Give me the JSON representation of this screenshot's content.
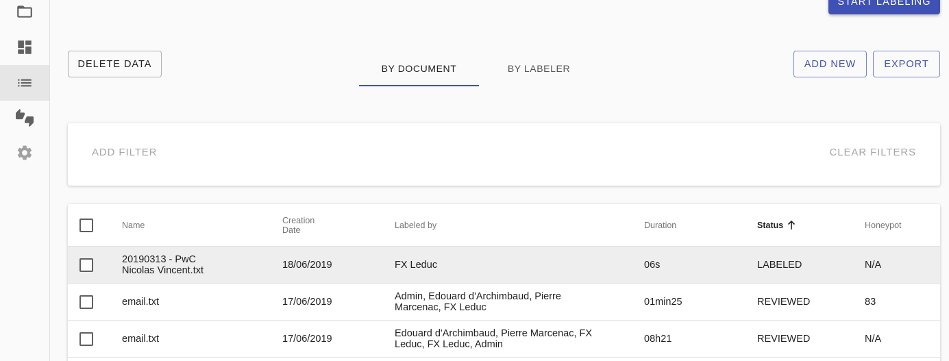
{
  "sidebar": {
    "items": [
      {
        "icon": "folder-icon"
      },
      {
        "icon": "dashboard-icon"
      },
      {
        "icon": "list-icon",
        "active": true
      },
      {
        "icon": "thumbs-up-down-icon"
      },
      {
        "icon": "settings-icon"
      }
    ]
  },
  "toolbar": {
    "start_label": "START LABELING",
    "delete_label": "DELETE DATA",
    "add_new_label": "ADD NEW",
    "export_label": "EXPORT"
  },
  "tabs": [
    {
      "label": "BY DOCUMENT",
      "active": true
    },
    {
      "label": "BY LABELER",
      "active": false
    }
  ],
  "filters": {
    "add_label": "ADD FILTER",
    "clear_label": "CLEAR FILTERS"
  },
  "table": {
    "columns": {
      "name": "Name",
      "creation_date_line1": "Creation",
      "creation_date_line2": "Date",
      "labeled_by": "Labeled by",
      "duration": "Duration",
      "status": "Status",
      "honeypot": "Honeypot"
    },
    "sort": {
      "column": "status",
      "direction": "ascending"
    },
    "rows": [
      {
        "name_line1": "20190313 - PwC",
        "name_line2": "Nicolas Vincent.txt",
        "date": "18/06/2019",
        "labeled_by_line1": "FX Leduc",
        "labeled_by_line2": "",
        "duration": "06s",
        "status": "LABELED",
        "honeypot": "N/A"
      },
      {
        "name_line1": "email.txt",
        "name_line2": "",
        "date": "17/06/2019",
        "labeled_by_line1": "Admin, Edouard d'Archimbaud, Pierre",
        "labeled_by_line2": "Marcenac, FX Leduc",
        "duration": "01min25",
        "status": "REVIEWED",
        "honeypot": "83"
      },
      {
        "name_line1": "email.txt",
        "name_line2": "",
        "date": "17/06/2019",
        "labeled_by_line1": "Edouard d'Archimbaud, Pierre Marcenac, FX",
        "labeled_by_line2": "Leduc, FX Leduc, Admin",
        "duration": "08h21",
        "status": "REVIEWED",
        "honeypot": "N/A"
      }
    ]
  },
  "colors": {
    "primary": "#3f51b5",
    "active_nav_bg": "#e6e6e6",
    "highlight_row": "#eeeeee"
  }
}
